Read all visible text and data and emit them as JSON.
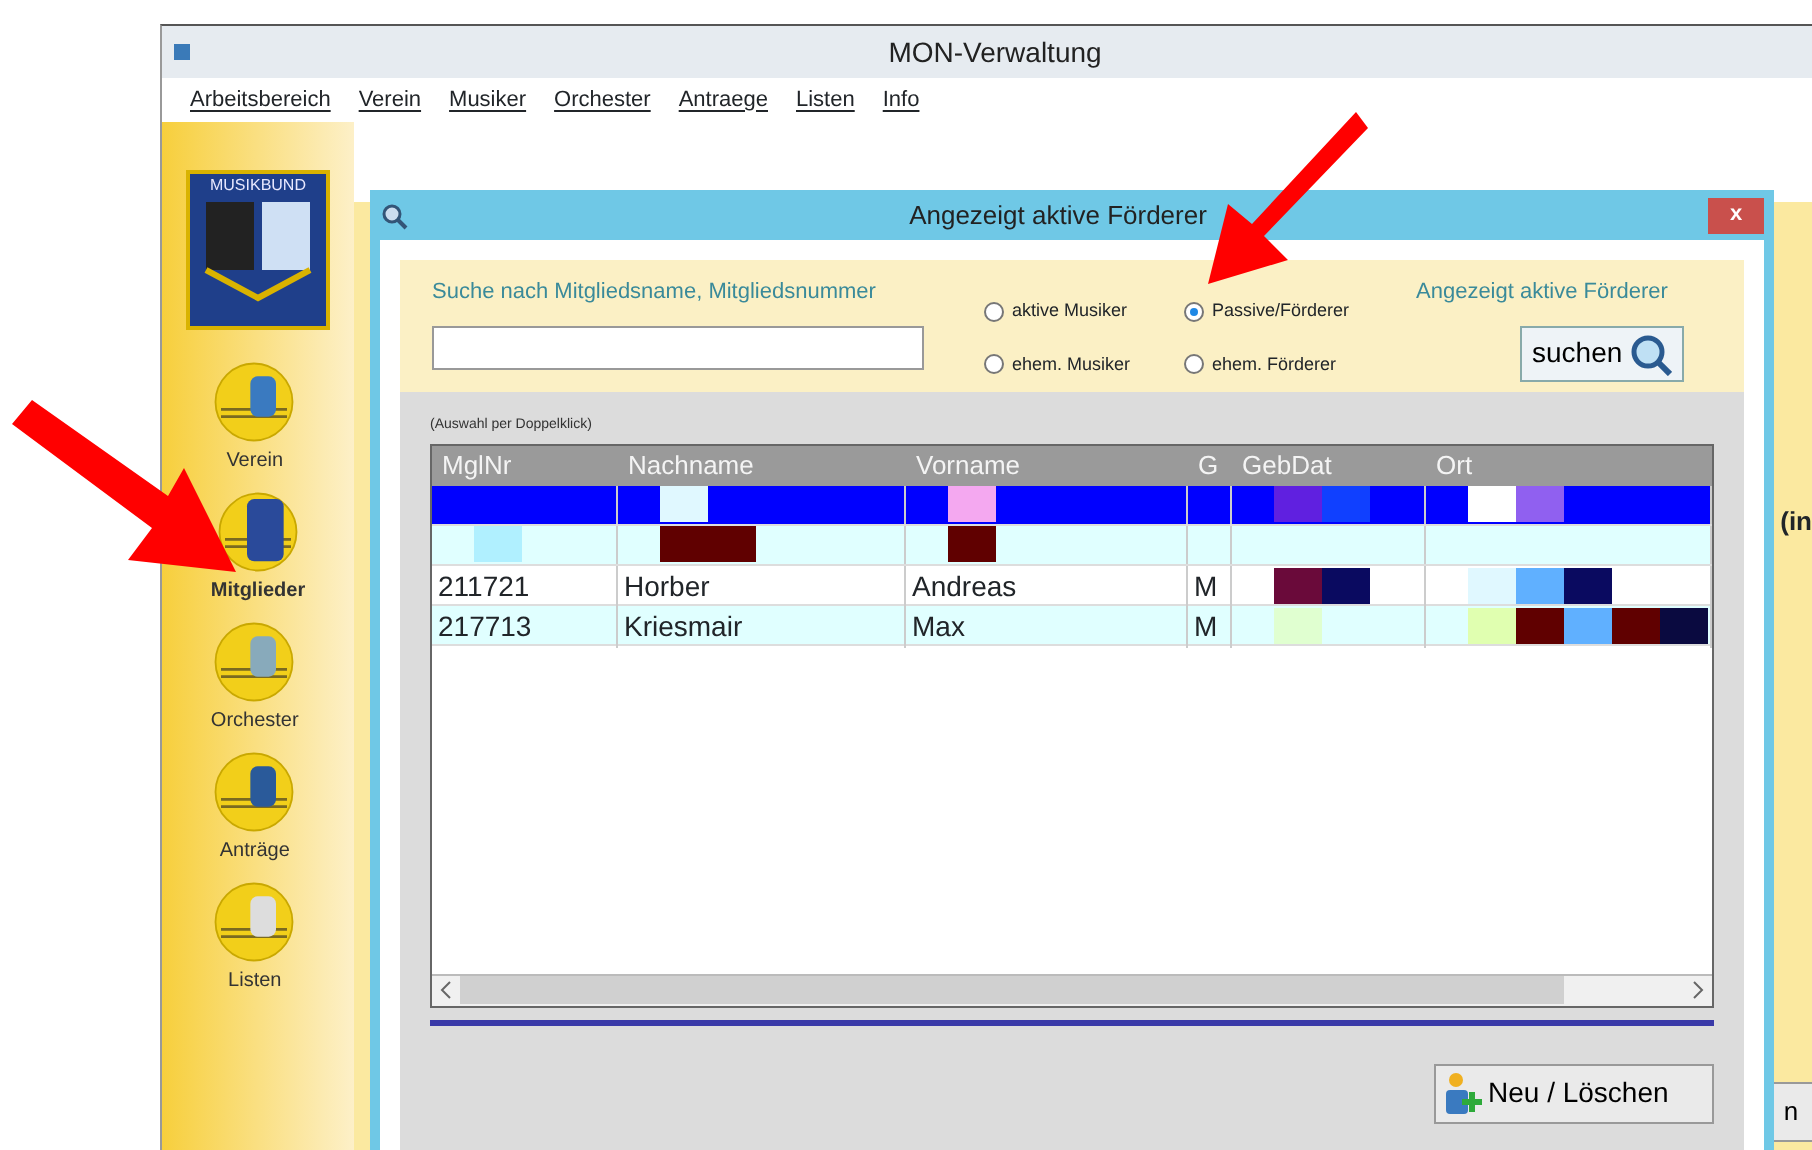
{
  "window": {
    "title": "MON-Verwaltung"
  },
  "menu": [
    "Arbeitsbereich",
    "Verein",
    "Musiker",
    "Orchester",
    "Antraege",
    "Listen",
    "Info"
  ],
  "logo": {
    "text": "MUSIKBUND"
  },
  "sidebar": {
    "items": [
      {
        "label": "Verein",
        "selected": false
      },
      {
        "label": "Mitglieder",
        "selected": true
      },
      {
        "label": "Orchester",
        "selected": false
      },
      {
        "label": "Anträge",
        "selected": false
      },
      {
        "label": "Listen",
        "selected": false
      }
    ]
  },
  "background": {
    "partial_label": "(in",
    "partial_button": "n"
  },
  "dialog": {
    "title": "Angezeigt aktive Förderer",
    "close": "x",
    "search": {
      "label": "Suche nach Mitgliedsname, Mitgliedsnummer",
      "status": "Angezeigt aktive Förderer",
      "button": "suchen",
      "options": [
        {
          "label": "aktive Musiker",
          "selected": false
        },
        {
          "label": "Passive/Förderer",
          "selected": true
        },
        {
          "label": "ehem. Musiker",
          "selected": false
        },
        {
          "label": "ehem. Förderer",
          "selected": false
        }
      ]
    },
    "hint": "(Auswahl per Doppelklick)",
    "table": {
      "columns": [
        "MglNr",
        "Nachname",
        "Vorname",
        "G",
        "GebDat",
        "Ort"
      ],
      "rows": [
        {
          "color": "#0000ff",
          "cells": [
            {},
            {
              "blocks": [
                {
                  "color": "#e0f8ff"
                }
              ]
            },
            {
              "blocks": [
                {
                  "color": "#f4a8f0"
                }
              ]
            },
            {},
            {
              "blocks": [
                {
                  "color": "#6020e0"
                },
                {
                  "color": "#1040ff"
                }
              ]
            },
            {
              "blocks": [
                {
                  "color": "#ffffff"
                },
                {
                  "color": "#9060f0"
                }
              ]
            }
          ]
        },
        {
          "color": "#e0ffff",
          "cells": [
            {
              "blocks": [
                {
                  "color": "#b0f0ff"
                }
              ]
            },
            {
              "blocks": [
                {
                  "color": "#600000"
                },
                {
                  "color": "#600000"
                }
              ]
            },
            {
              "blocks": [
                {
                  "color": "#600000"
                }
              ]
            },
            {},
            {},
            {}
          ]
        },
        {
          "color": "#ffffff",
          "cells": [
            {
              "text": "211721"
            },
            {
              "text": "Horber"
            },
            {
              "text": "Andreas"
            },
            {
              "text": "M"
            },
            {
              "blocks": [
                {
                  "color": "#6a0a3a"
                },
                {
                  "color": "#0a0a60"
                }
              ]
            },
            {
              "blocks": [
                {
                  "color": "#e0f8ff"
                },
                {
                  "color": "#60b0ff"
                },
                {
                  "color": "#0a0a60"
                }
              ]
            }
          ]
        },
        {
          "color": "#e0ffff",
          "cells": [
            {
              "text": "217713"
            },
            {
              "text": "Kriesmair"
            },
            {
              "text": "Max"
            },
            {
              "text": "M"
            },
            {
              "blocks": [
                {
                  "color": "#e0ffd0"
                }
              ]
            },
            {
              "blocks": [
                {
                  "color": "#e0ffb0"
                },
                {
                  "color": "#600000"
                },
                {
                  "color": "#60b0ff"
                },
                {
                  "color": "#600000"
                },
                {
                  "color": "#0a0a40"
                }
              ]
            }
          ]
        }
      ]
    },
    "button": "Neu / Löschen"
  }
}
